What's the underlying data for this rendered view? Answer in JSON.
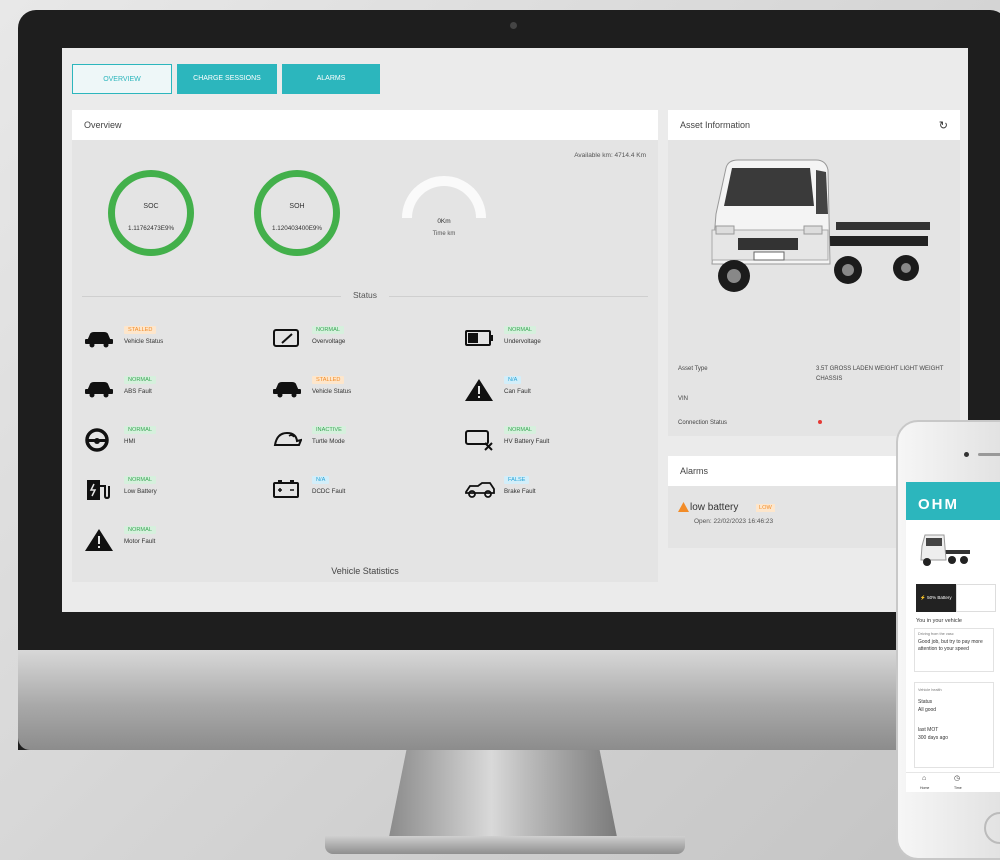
{
  "tabs": [
    {
      "label": "OVERVIEW",
      "active": true
    },
    {
      "label": "CHARGE SESSIONS",
      "active": false
    },
    {
      "label": "ALARMS",
      "active": false
    }
  ],
  "overview": {
    "title": "Overview",
    "available": "Available km: 4714.4 Km",
    "soc": {
      "label": "SOC",
      "value": "1.11762473E9%"
    },
    "soh": {
      "label": "SOH",
      "value": "1.120403400E9%"
    },
    "range": {
      "value": "0Km",
      "label": "Time km"
    },
    "status_title": "Status",
    "vehicle_statistics": "Vehicle Statistics",
    "statuses": [
      {
        "badge": "STALLED",
        "name": "Vehicle Status",
        "icon": "car-icon",
        "color": "orange"
      },
      {
        "badge": "NORMAL",
        "name": "Overvoltage",
        "icon": "voltage-gauge-icon",
        "color": "green"
      },
      {
        "badge": "NORMAL",
        "name": "Undervoltage",
        "icon": "battery-icon",
        "color": "green"
      },
      {
        "badge": "NORMAL",
        "name": "ABS Fault",
        "icon": "car-icon",
        "color": "green"
      },
      {
        "badge": "STALLED",
        "name": "Vehicle Status",
        "icon": "car-icon",
        "color": "orange"
      },
      {
        "badge": "N/A",
        "name": "Can Fault",
        "icon": "warning-icon",
        "color": "blue"
      },
      {
        "badge": "NORMAL",
        "name": "HMI",
        "icon": "steering-wheel-icon",
        "color": "green"
      },
      {
        "badge": "INACTIVE",
        "name": "Turtle Mode",
        "icon": "turtle-icon",
        "color": "green"
      },
      {
        "badge": "NORMAL",
        "name": "HV Battery Fault",
        "icon": "battery-fault-icon",
        "color": "green"
      },
      {
        "badge": "NORMAL",
        "name": "Low Battery",
        "icon": "charging-station-icon",
        "color": "green"
      },
      {
        "badge": "N/A",
        "name": "DCDC Fault",
        "icon": "dcdc-battery-icon",
        "color": "blue"
      },
      {
        "badge": "FALSE",
        "name": "Brake Fault",
        "icon": "brake-icon",
        "color": "blue"
      },
      {
        "badge": "NORMAL",
        "name": "Motor Fault",
        "icon": "warning-icon",
        "color": "green"
      }
    ]
  },
  "asset": {
    "title": "Asset Information",
    "type_label": "Asset Type",
    "type_value": "3.5T GROSS LADEN WEIGHT LIGHT WEIGHT CHASSIS",
    "vin_label": "VIN",
    "conn_label": "Connection Status"
  },
  "alarms": {
    "title": "Alarms",
    "name": "low battery",
    "level": "LOW",
    "opened": "Open: 22/02/2023 16:46:23"
  },
  "phone": {
    "logo": "OHM",
    "btn_label": "50% Battery",
    "btn2_label": "",
    "section": "You in your vehicle",
    "card1_title": "Driving from the vasc",
    "card1_text": "Good job, but try to pay more attention to your speed",
    "card2_title": "Vehicle health",
    "card2_l1": "Status",
    "card2_l2": "All good",
    "card2_l3": "last MOT",
    "card2_l4": "300 days ago",
    "nav_home": "Home",
    "nav_time": "Time"
  },
  "colors": {
    "accent": "#2cb6bd",
    "ring": "#43b04b",
    "warning": "#f28c28"
  }
}
